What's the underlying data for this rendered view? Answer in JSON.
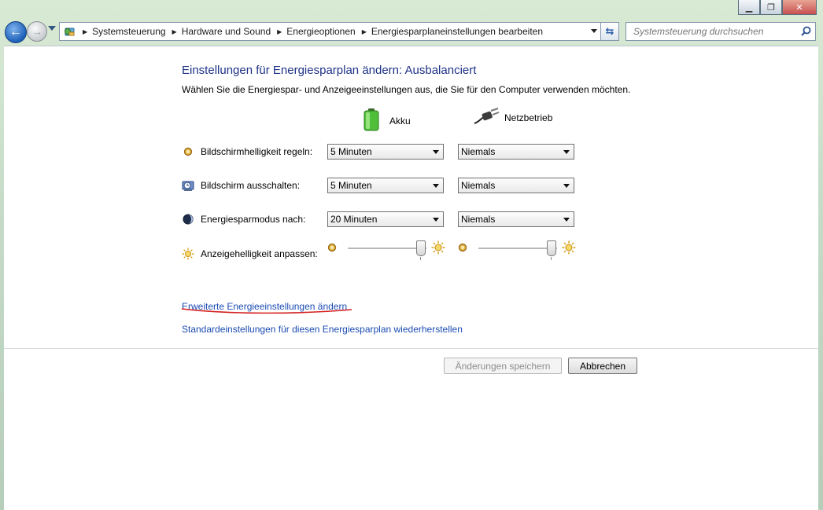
{
  "nav": {
    "breadcrumbs": [
      {
        "label": "Systemsteuerung"
      },
      {
        "label": "Hardware und Sound"
      },
      {
        "label": "Energieoptionen"
      },
      {
        "label": "Energiesparplaneinstellungen bearbeiten"
      }
    ],
    "search_placeholder": "Systemsteuerung durchsuchen"
  },
  "page": {
    "title": "Einstellungen für Energiesparplan ändern: Ausbalanciert",
    "subtitle": "Wählen Sie die Energiespar- und Anzeigeeinstellungen aus, die Sie für den Computer verwenden möchten."
  },
  "columns": {
    "battery": "Akku",
    "plugged": "Netzbetrieb"
  },
  "settings": [
    {
      "label": "Bildschirmhelligkeit regeln:",
      "battery": "5 Minuten",
      "plugged": "Niemals"
    },
    {
      "label": "Bildschirm ausschalten:",
      "battery": "5 Minuten",
      "plugged": "Niemals"
    },
    {
      "label": "Energiesparmodus nach:",
      "battery": "20 Minuten",
      "plugged": "Niemals"
    }
  ],
  "brightness": {
    "label": "Anzeigehelligkeit anpassen:",
    "battery_level": 0.92,
    "plugged_level": 0.92
  },
  "links": {
    "advanced": "Erweiterte Energieeinstellungen ändern",
    "restore": "Standardeinstellungen für diesen Energiesparplan wiederherstellen"
  },
  "buttons": {
    "save": "Änderungen speichern",
    "cancel": "Abbrechen"
  },
  "colors": {
    "title": "#1e3287",
    "link": "#1a4bb3",
    "annotation": "#d42020"
  }
}
